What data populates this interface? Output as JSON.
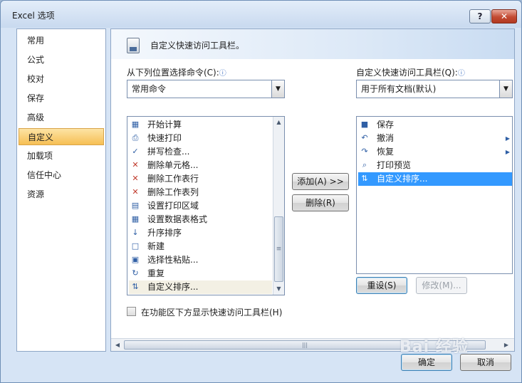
{
  "window": {
    "title": "Excel 选项"
  },
  "titlebar": {
    "help": "?",
    "close": "✕"
  },
  "nav": {
    "items": [
      {
        "label": "常用"
      },
      {
        "label": "公式"
      },
      {
        "label": "校对"
      },
      {
        "label": "保存"
      },
      {
        "label": "高级"
      },
      {
        "label": "自定义",
        "active": true
      },
      {
        "label": "加载项"
      },
      {
        "label": "信任中心"
      },
      {
        "label": "资源"
      }
    ]
  },
  "banner": {
    "title": "自定义快速访问工具栏。"
  },
  "left_panel": {
    "label": "从下列位置选择命令(C):",
    "info_mark": "ⓘ",
    "dropdown_value": "常用命令",
    "commands": [
      {
        "icon": "calculator-icon",
        "glyph": "▦",
        "label": "开始计算"
      },
      {
        "icon": "printer-icon",
        "glyph": "⎙",
        "label": "快速打印"
      },
      {
        "icon": "spellcheck-icon",
        "glyph": "✓",
        "label": "拼写检查..."
      },
      {
        "icon": "delete-cells-icon",
        "glyph": "✕",
        "label": "删除单元格..."
      },
      {
        "icon": "delete-rows-icon",
        "glyph": "✕",
        "label": "删除工作表行"
      },
      {
        "icon": "delete-columns-icon",
        "glyph": "✕",
        "label": "删除工作表列"
      },
      {
        "icon": "print-area-icon",
        "glyph": "▤",
        "label": "设置打印区域"
      },
      {
        "icon": "format-table-icon",
        "glyph": "▦",
        "label": "设置数据表格式"
      },
      {
        "icon": "sort-ascending-icon",
        "glyph": "↓",
        "label": "升序排序"
      },
      {
        "icon": "new-document-icon",
        "glyph": "□",
        "label": "新建"
      },
      {
        "icon": "paste-special-icon",
        "glyph": "▣",
        "label": "选择性粘贴..."
      },
      {
        "icon": "redo-icon",
        "glyph": "↻",
        "label": "重复"
      },
      {
        "icon": "custom-sort-icon",
        "glyph": "⇅",
        "label": "自定义排序..."
      }
    ]
  },
  "right_panel": {
    "label": "自定义快速访问工具栏(Q):",
    "info_mark": "ⓘ",
    "dropdown_value": "用于所有文档(默认)",
    "commands": [
      {
        "icon": "save-icon",
        "glyph": "■",
        "label": "保存"
      },
      {
        "icon": "undo-icon",
        "glyph": "↶",
        "label": "撤消",
        "submenu": true
      },
      {
        "icon": "redo-icon",
        "glyph": "↷",
        "label": "恢复",
        "submenu": true
      },
      {
        "icon": "print-preview-icon",
        "glyph": "⌕",
        "label": "打印预览"
      },
      {
        "icon": "custom-sort-icon",
        "glyph": "⇅",
        "label": "自定义排序...",
        "selected": true
      }
    ]
  },
  "buttons": {
    "add": "添加(A) >>",
    "remove": "删除(R)",
    "reset": "重设(S)",
    "modify": "修改(M)...",
    "ok": "确定",
    "cancel": "取消"
  },
  "checkbox": {
    "label": "在功能区下方显示快速访问工具栏(H)",
    "checked": false
  },
  "scroll": {
    "up": "▲",
    "down": "▼",
    "left": "◀",
    "right": "▶",
    "grip": "|||",
    "grip_v": "≡"
  },
  "combo": {
    "arrow": "▼"
  },
  "watermark": {
    "text": "Bai 经验"
  }
}
